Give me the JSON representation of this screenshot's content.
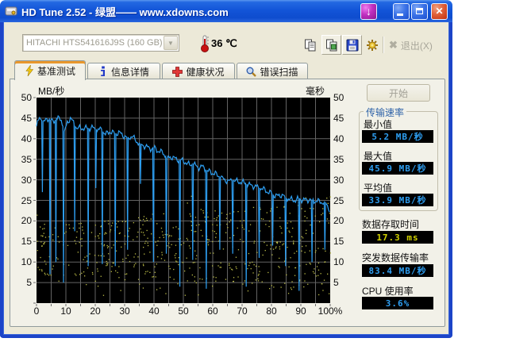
{
  "window": {
    "title": "HD Tune 2.52 - 绿盟—— www.xdowns.com"
  },
  "drive_selector": {
    "value": "HITACHI HTS541616J9S (160 GB)"
  },
  "temperature": "36 ℃",
  "toolbar": {
    "exit_label": "退出(X)"
  },
  "tabs": [
    {
      "label": "基准测试",
      "icon": "benchmark-icon",
      "active": true
    },
    {
      "label": "信息详情",
      "icon": "info-icon",
      "active": false
    },
    {
      "label": "健康状况",
      "icon": "health-icon",
      "active": false
    },
    {
      "label": "错误扫描",
      "icon": "scan-icon",
      "active": false
    }
  ],
  "benchmark": {
    "start_label": "开始",
    "transfer_rate_group": "传输速率",
    "min_label": "最小值",
    "min_value": "5.2 MB/秒",
    "max_label": "最大值",
    "max_value": "45.9 MB/秒",
    "avg_label": "平均值",
    "avg_value": "33.9 MB/秒",
    "access_label": "数据存取时间",
    "access_value": "17.3 ms",
    "burst_label": "突发数据传输率",
    "burst_value": "83.4 MB/秒",
    "cpu_label": "CPU 使用率",
    "cpu_value": "3.6%"
  },
  "chart_data": {
    "type": "line",
    "title": "HD Tune benchmark: transfer rate (MB/s) vs disk position (%), with access-time scatter (ms)",
    "y_left_label": "MB/秒",
    "y_right_label": "毫秒",
    "y_ticks": [
      "50",
      "45",
      "40",
      "35",
      "30",
      "25",
      "20",
      "15",
      "10",
      "5"
    ],
    "x_ticks": [
      "0",
      "10",
      "20",
      "30",
      "40",
      "50",
      "60",
      "70",
      "80",
      "90",
      "100%"
    ],
    "x_range": [
      0,
      100
    ],
    "y_range": [
      0,
      50
    ],
    "grid": true,
    "grid_color": "#646464",
    "background": "#000000",
    "series": [
      {
        "name": "transfer-rate",
        "type": "line",
        "color": "#2E9FF2",
        "baseline": [
          [
            0,
            43
          ],
          [
            1,
            45
          ],
          [
            2.5,
            44
          ],
          [
            4,
            45
          ],
          [
            5.5,
            44
          ],
          [
            7,
            45
          ],
          [
            8.5,
            44.5
          ],
          [
            9.5,
            41.5
          ],
          [
            10.5,
            44
          ],
          [
            11.5,
            45
          ],
          [
            12.5,
            44
          ],
          [
            13.5,
            42.5
          ],
          [
            15,
            42.6
          ],
          [
            17,
            42.5
          ],
          [
            19,
            42.7
          ],
          [
            20.5,
            42
          ],
          [
            22,
            42.3
          ],
          [
            23.5,
            41
          ],
          [
            25,
            41.8
          ],
          [
            26.5,
            41.2
          ],
          [
            28,
            41.5
          ],
          [
            29.5,
            40.8
          ],
          [
            31,
            40.2
          ],
          [
            32.5,
            40.6
          ],
          [
            34,
            39.4
          ],
          [
            35.5,
            38.6
          ],
          [
            37,
            38.2
          ],
          [
            38.5,
            37.6
          ],
          [
            40,
            37.8
          ],
          [
            41.5,
            37
          ],
          [
            43,
            36.6
          ],
          [
            44.5,
            35.2
          ],
          [
            46,
            35.6
          ],
          [
            47.5,
            35
          ],
          [
            49,
            34.8
          ],
          [
            50.5,
            34.4
          ],
          [
            52,
            33.6
          ],
          [
            53.5,
            33.8
          ],
          [
            55,
            33
          ],
          [
            56.5,
            33.2
          ],
          [
            58,
            32.2
          ],
          [
            59.5,
            31.8
          ],
          [
            61,
            31.4
          ],
          [
            62.5,
            30.6
          ],
          [
            64,
            30
          ],
          [
            65.5,
            29.6
          ],
          [
            67,
            29.8
          ],
          [
            68.5,
            29.6
          ],
          [
            70,
            29.4
          ],
          [
            71.5,
            29
          ],
          [
            73,
            28.6
          ],
          [
            74.5,
            28.4
          ],
          [
            76,
            28
          ],
          [
            77.5,
            27.6
          ],
          [
            79,
            27
          ],
          [
            80.5,
            26.4
          ],
          [
            82,
            26
          ],
          [
            83.5,
            26.4
          ],
          [
            85,
            25.6
          ],
          [
            86.5,
            25.2
          ],
          [
            88,
            25
          ],
          [
            89.5,
            25.4
          ],
          [
            91,
            25
          ],
          [
            92.5,
            25.2
          ],
          [
            94,
            25
          ],
          [
            95.5,
            24.8
          ],
          [
            97,
            24.6
          ],
          [
            98.5,
            24.4
          ],
          [
            100,
            22.5
          ]
        ],
        "dips": [
          [
            2,
            27
          ],
          [
            4.6,
            7
          ],
          [
            6.6,
            10
          ],
          [
            9.2,
            5
          ],
          [
            13,
            17.5
          ],
          [
            17.6,
            9
          ],
          [
            20.2,
            28
          ],
          [
            22.4,
            9.5
          ],
          [
            26.8,
            9
          ],
          [
            31,
            13
          ],
          [
            35.4,
            29
          ],
          [
            39.8,
            10
          ],
          [
            44.2,
            12
          ],
          [
            48.8,
            4
          ],
          [
            53.2,
            10.5
          ],
          [
            57.8,
            3.5
          ],
          [
            62.4,
            13
          ],
          [
            66.8,
            12
          ],
          [
            71.4,
            4
          ],
          [
            75.8,
            11
          ],
          [
            80.4,
            14
          ],
          [
            84.8,
            9
          ],
          [
            89.4,
            3
          ],
          [
            93.8,
            10
          ],
          [
            98.2,
            13
          ]
        ]
      },
      {
        "name": "access-time",
        "type": "scatter",
        "color": "#BCBC46",
        "count": 560,
        "seed": 12345,
        "band_low_start": 7,
        "band_low_end": 3,
        "band_high_start": 19,
        "band_high_end": 26
      }
    ],
    "stats": {
      "minimum_mb_s": 5.2,
      "maximum_mb_s": 45.9,
      "average_mb_s": 33.9,
      "access_time_ms": 17.3,
      "burst_rate_mb_s": 83.4,
      "cpu_usage_pct": 3.6
    }
  }
}
